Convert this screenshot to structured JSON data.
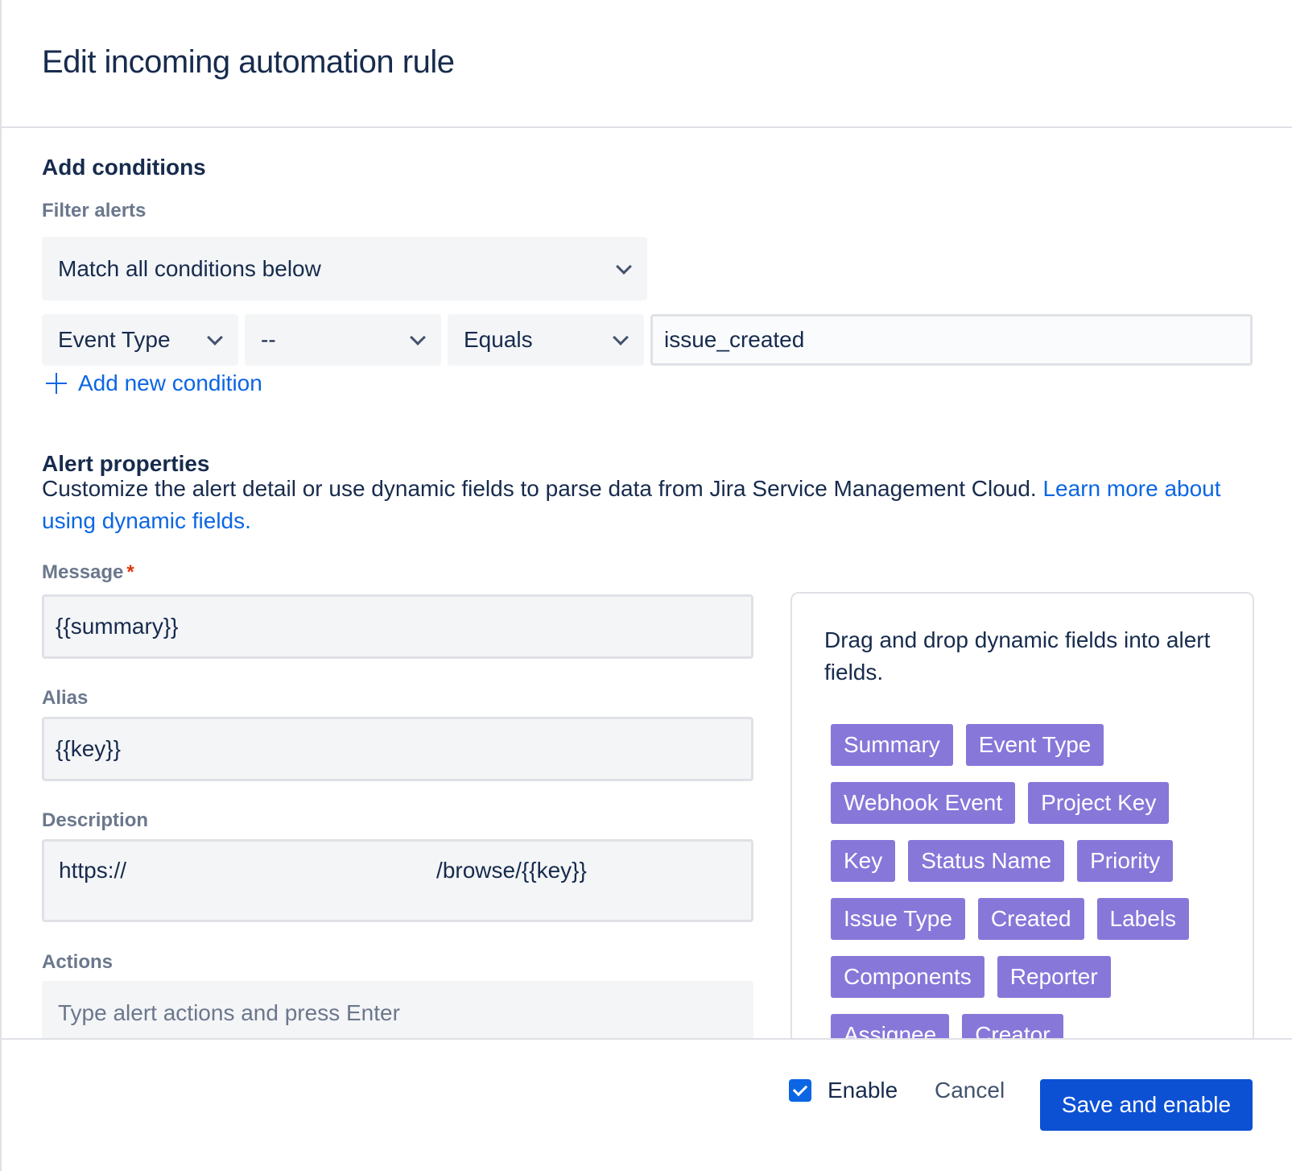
{
  "dialog": {
    "title": "Edit incoming automation rule"
  },
  "conditions": {
    "heading": "Add conditions",
    "filter_label": "Filter alerts",
    "match_select": "Match all conditions below",
    "field_select": "Event Type",
    "modifier_select": "--",
    "operator_select": "Equals",
    "value": "issue_created",
    "add_label": "Add new condition"
  },
  "alert_props": {
    "heading": "Alert properties",
    "description": "Customize the alert detail or use dynamic fields to parse data from Jira Service Management Cloud.",
    "learn_more": "Learn more about using dynamic fields.",
    "message_label": "Message",
    "message_required": "*",
    "message_value": "{{summary}}",
    "alias_label": "Alias",
    "alias_value": "{{key}}",
    "description_label": "Description",
    "description_prefix": "https://",
    "description_suffix": "/browse/{{key}}",
    "actions_label": "Actions",
    "actions_placeholder": "Type alert actions and press Enter"
  },
  "dynamic_fields": {
    "hint": "Drag and drop dynamic fields into alert fields.",
    "rows": [
      [
        "Summary",
        "Event Type"
      ],
      [
        "Webhook Event",
        "Project Key"
      ],
      [
        "Key",
        "Status Name",
        "Priority"
      ],
      [
        "Issue Type",
        "Created",
        "Labels"
      ],
      [
        "Components",
        "Reporter"
      ],
      [
        "Assignee",
        "Creator"
      ]
    ]
  },
  "footer": {
    "enable_label": "Enable",
    "enable_checked": true,
    "cancel_label": "Cancel",
    "save_label": "Save and enable"
  },
  "colors": {
    "primary": "#0c51d4",
    "link": "#0c66e4",
    "chip": "#8777d9"
  }
}
